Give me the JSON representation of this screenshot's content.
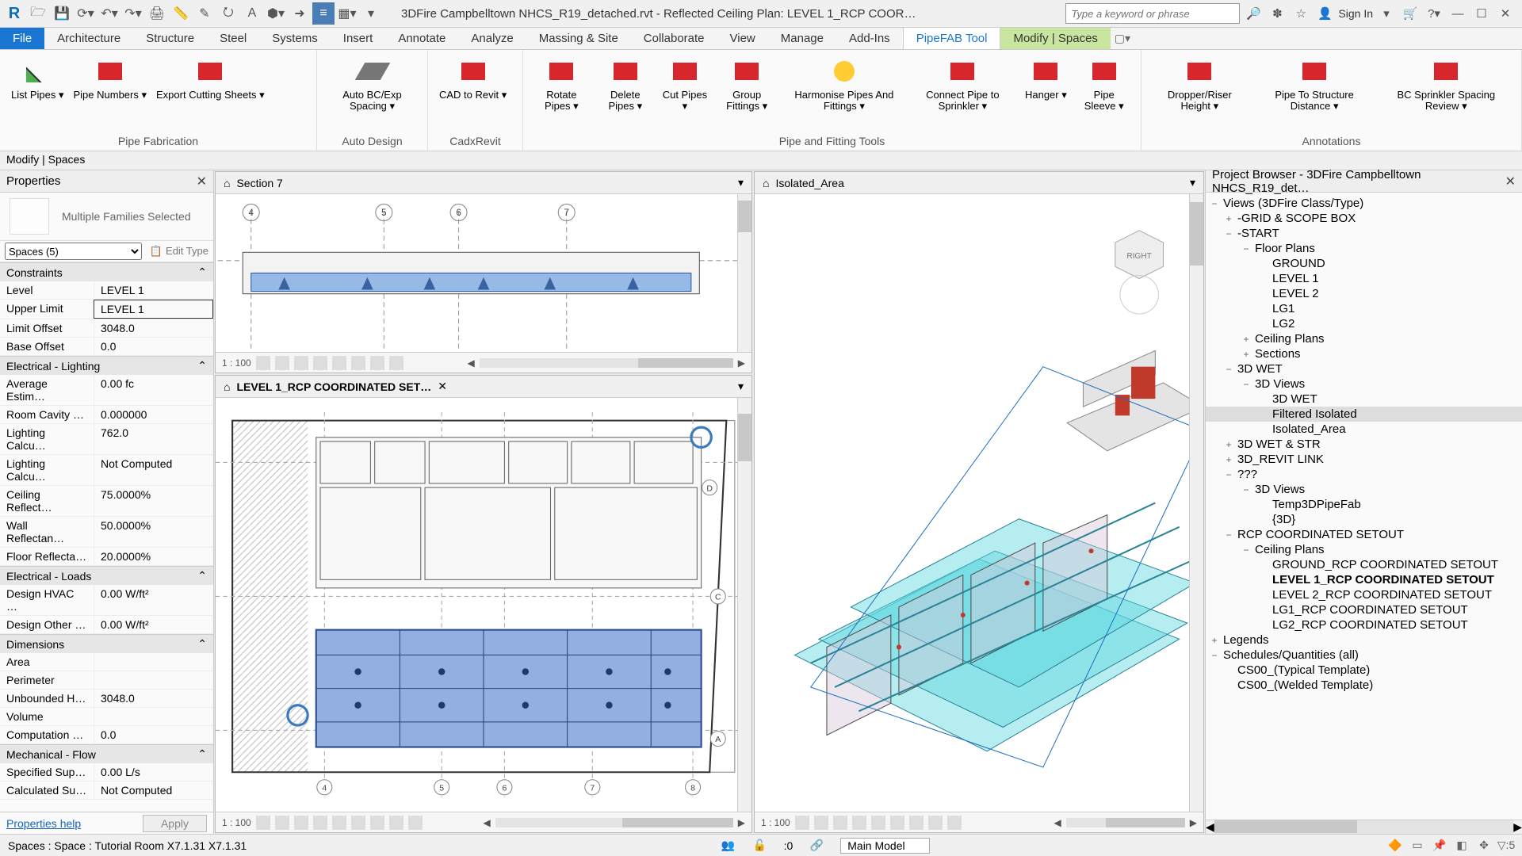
{
  "title": "3DFire Campbelltown NHCS_R19_detached.rvt - Reflected Ceiling Plan: LEVEL 1_RCP COOR…",
  "search_placeholder": "Type a keyword or phrase",
  "signin": "Sign In",
  "tabs": [
    "File",
    "Architecture",
    "Structure",
    "Steel",
    "Systems",
    "Insert",
    "Annotate",
    "Analyze",
    "Massing & Site",
    "Collaborate",
    "View",
    "Manage",
    "Add-Ins",
    "PipeFAB Tool",
    "Modify | Spaces"
  ],
  "active_tab_index": 13,
  "context_tab_index": 14,
  "ribbon": {
    "pipe_fabrication": {
      "label": "Pipe Fabrication",
      "items": [
        "List Pipes",
        "Pipe Numbers",
        "Export Cutting Sheets"
      ]
    },
    "auto_design": {
      "label": "Auto Design",
      "items": [
        "Auto BC/Exp Spacing"
      ]
    },
    "cadxrevit": {
      "label": "CadxRevit",
      "items": [
        "CAD to Revit"
      ]
    },
    "pipe_fitting": {
      "label": "Pipe and Fitting Tools",
      "items": [
        "Rotate Pipes",
        "Delete Pipes",
        "Cut Pipes",
        "Group Fittings",
        "Harmonise Pipes And Fittings",
        "Connect Pipe to Sprinkler",
        "Hanger",
        "Pipe Sleeve"
      ]
    },
    "annotations": {
      "label": "Annotations",
      "items": [
        "Dropper/Riser Height",
        "Pipe To Structure Distance",
        "BC Sprinkler Spacing Review"
      ]
    }
  },
  "context_bar": "Modify | Spaces",
  "properties": {
    "title": "Properties",
    "family": "Multiple Families Selected",
    "selector": "Spaces (5)",
    "edit_type": "Edit Type",
    "apply": "Apply",
    "help": "Properties help",
    "groups": [
      {
        "name": "Constraints",
        "rows": [
          {
            "k": "Level",
            "v": "LEVEL 1"
          },
          {
            "k": "Upper Limit",
            "v": "LEVEL 1",
            "bold": true
          },
          {
            "k": "Limit Offset",
            "v": "3048.0"
          },
          {
            "k": "Base Offset",
            "v": "0.0"
          }
        ]
      },
      {
        "name": "Electrical - Lighting",
        "rows": [
          {
            "k": "Average Estim…",
            "v": "0.00 fc"
          },
          {
            "k": "Room Cavity …",
            "v": "0.000000"
          },
          {
            "k": "Lighting Calcu…",
            "v": "762.0"
          },
          {
            "k": "Lighting Calcu…",
            "v": "Not Computed"
          },
          {
            "k": "Ceiling Reflect…",
            "v": "75.0000%"
          },
          {
            "k": "Wall Reflectan…",
            "v": "50.0000%"
          },
          {
            "k": "Floor Reflecta…",
            "v": "20.0000%"
          }
        ]
      },
      {
        "name": "Electrical - Loads",
        "rows": [
          {
            "k": "Design HVAC …",
            "v": "0.00 W/ft²"
          },
          {
            "k": "Design Other …",
            "v": "0.00 W/ft²"
          }
        ]
      },
      {
        "name": "Dimensions",
        "rows": [
          {
            "k": "Area",
            "v": ""
          },
          {
            "k": "Perimeter",
            "v": ""
          },
          {
            "k": "Unbounded H…",
            "v": "3048.0"
          },
          {
            "k": "Volume",
            "v": ""
          },
          {
            "k": "Computation …",
            "v": "0.0"
          }
        ]
      },
      {
        "name": "Mechanical - Flow",
        "rows": [
          {
            "k": "Specified Sup…",
            "v": "0.00 L/s"
          },
          {
            "k": "Calculated Su…",
            "v": "Not Computed"
          }
        ]
      }
    ]
  },
  "views": {
    "section": {
      "tab": "Section 7",
      "scale": "1 : 100"
    },
    "rcp": {
      "tab": "LEVEL 1_RCP COORDINATED SET…",
      "scale": "1 : 100"
    },
    "iso": {
      "tab": "Isolated_Area",
      "scale": "1 : 100"
    }
  },
  "browser": {
    "title": "Project Browser - 3DFire Campbelltown NHCS_R19_det…",
    "nodes": [
      {
        "ind": 0,
        "tg": "−",
        "txt": "Views (3DFire Class/Type)",
        "ic": "views"
      },
      {
        "ind": 1,
        "tg": "+",
        "txt": "-GRID & SCOPE BOX"
      },
      {
        "ind": 1,
        "tg": "−",
        "txt": "-START"
      },
      {
        "ind": 2,
        "tg": "−",
        "txt": "Floor Plans"
      },
      {
        "ind": 3,
        "tg": "",
        "txt": "GROUND"
      },
      {
        "ind": 3,
        "tg": "",
        "txt": "LEVEL 1"
      },
      {
        "ind": 3,
        "tg": "",
        "txt": "LEVEL 2"
      },
      {
        "ind": 3,
        "tg": "",
        "txt": "LG1"
      },
      {
        "ind": 3,
        "tg": "",
        "txt": "LG2"
      },
      {
        "ind": 2,
        "tg": "+",
        "txt": "Ceiling Plans"
      },
      {
        "ind": 2,
        "tg": "+",
        "txt": "Sections"
      },
      {
        "ind": 1,
        "tg": "−",
        "txt": "3D WET"
      },
      {
        "ind": 2,
        "tg": "−",
        "txt": "3D Views"
      },
      {
        "ind": 3,
        "tg": "",
        "txt": "3D WET"
      },
      {
        "ind": 3,
        "tg": "",
        "txt": "Filtered Isolated",
        "sel": true
      },
      {
        "ind": 3,
        "tg": "",
        "txt": "Isolated_Area"
      },
      {
        "ind": 1,
        "tg": "+",
        "txt": "3D WET & STR"
      },
      {
        "ind": 1,
        "tg": "+",
        "txt": "3D_REVIT LINK"
      },
      {
        "ind": 1,
        "tg": "−",
        "txt": "???"
      },
      {
        "ind": 2,
        "tg": "−",
        "txt": "3D Views"
      },
      {
        "ind": 3,
        "tg": "",
        "txt": "Temp3DPipeFab"
      },
      {
        "ind": 3,
        "tg": "",
        "txt": "{3D}"
      },
      {
        "ind": 1,
        "tg": "−",
        "txt": "RCP COORDINATED SETOUT"
      },
      {
        "ind": 2,
        "tg": "−",
        "txt": "Ceiling Plans"
      },
      {
        "ind": 3,
        "tg": "",
        "txt": "GROUND_RCP COORDINATED SETOUT"
      },
      {
        "ind": 3,
        "tg": "",
        "txt": "LEVEL 1_RCP COORDINATED SETOUT",
        "bold": true
      },
      {
        "ind": 3,
        "tg": "",
        "txt": "LEVEL 2_RCP COORDINATED SETOUT"
      },
      {
        "ind": 3,
        "tg": "",
        "txt": "LG1_RCP COORDINATED SETOUT"
      },
      {
        "ind": 3,
        "tg": "",
        "txt": "LG2_RCP COORDINATED SETOUT"
      },
      {
        "ind": 0,
        "tg": "+",
        "txt": "Legends",
        "ic": "legend"
      },
      {
        "ind": 0,
        "tg": "−",
        "txt": "Schedules/Quantities (all)",
        "ic": "sched"
      },
      {
        "ind": 1,
        "tg": "",
        "txt": "CS00_(Typical Template)"
      },
      {
        "ind": 1,
        "tg": "",
        "txt": "CS00_(Welded Template)"
      }
    ]
  },
  "status": {
    "left": "Spaces : Space : Tutorial Room X7.1.31 X7.1.31",
    "sel": ":0",
    "workset": "Main Model"
  }
}
